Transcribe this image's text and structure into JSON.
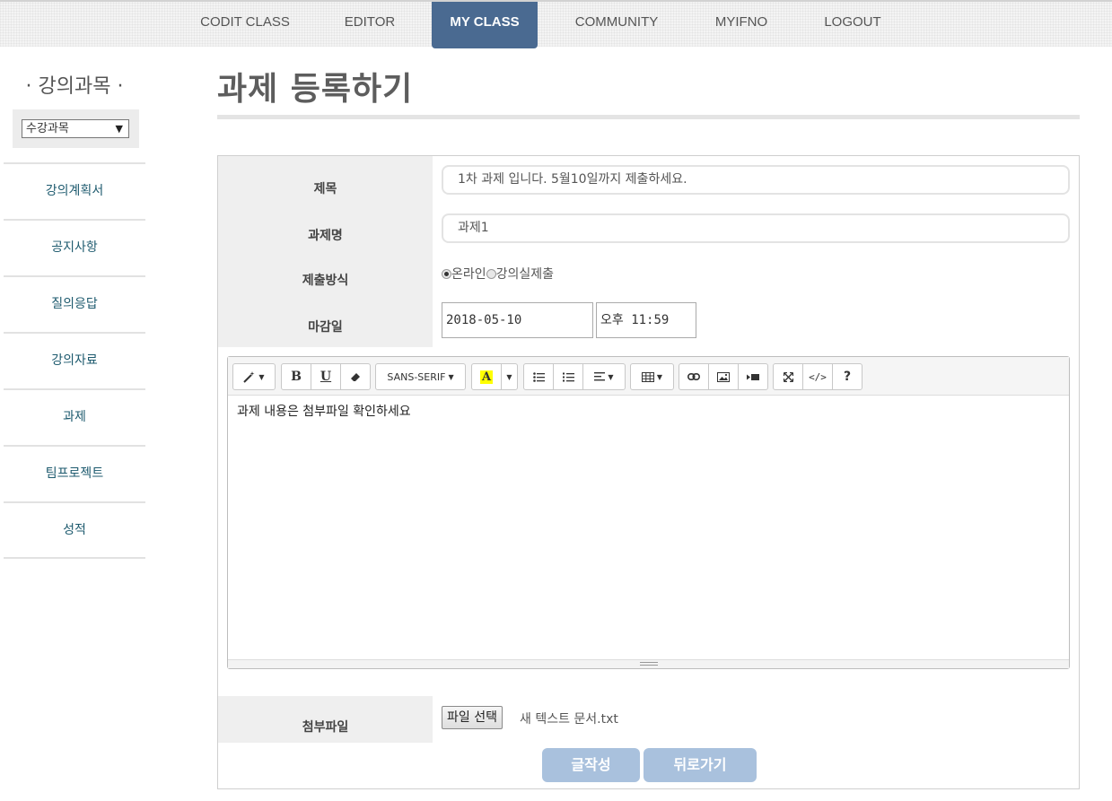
{
  "nav": {
    "items": [
      {
        "label": "CODIT CLASS"
      },
      {
        "label": "EDITOR"
      },
      {
        "label": "MY CLASS"
      },
      {
        "label": "COMMUNITY"
      },
      {
        "label": "MYIFNO"
      },
      {
        "label": "LOGOUT"
      }
    ],
    "active": "MY CLASS",
    "active_color": "#4a6a91"
  },
  "sidebar": {
    "title": "· 강의과목 ·",
    "course_select": {
      "value": "수강과목"
    },
    "items": [
      {
        "label": "강의계획서"
      },
      {
        "label": "공지사항"
      },
      {
        "label": "질의응답"
      },
      {
        "label": "강의자료"
      },
      {
        "label": "과제"
      },
      {
        "label": "팀프로젝트"
      },
      {
        "label": "성적"
      }
    ]
  },
  "page": {
    "title": "과제 등록하기"
  },
  "form": {
    "title_label": "제목",
    "title_value": "1차 과제 입니다. 5월10일까지 제출하세요.",
    "name_label": "과제명",
    "name_value": "과제1",
    "method_label": "제출방식",
    "method_options": [
      {
        "label": "온라인",
        "checked": true
      },
      {
        "label": "강의실제출",
        "checked": false
      }
    ],
    "deadline_label": "마감일",
    "deadline_date": "2018-05-10",
    "deadline_time": "오후 11:59",
    "editor": {
      "font_label": "SANS-SERIF",
      "content": "과제 내용은 첨부파일 확인하세요"
    },
    "attach_label": "첨부파일",
    "file_button": "파일 선택",
    "file_name": "새 텍스트 문서.txt",
    "submit_button": "글작성",
    "back_button": "뒤로가기",
    "button_color": "#a9c1dd"
  }
}
